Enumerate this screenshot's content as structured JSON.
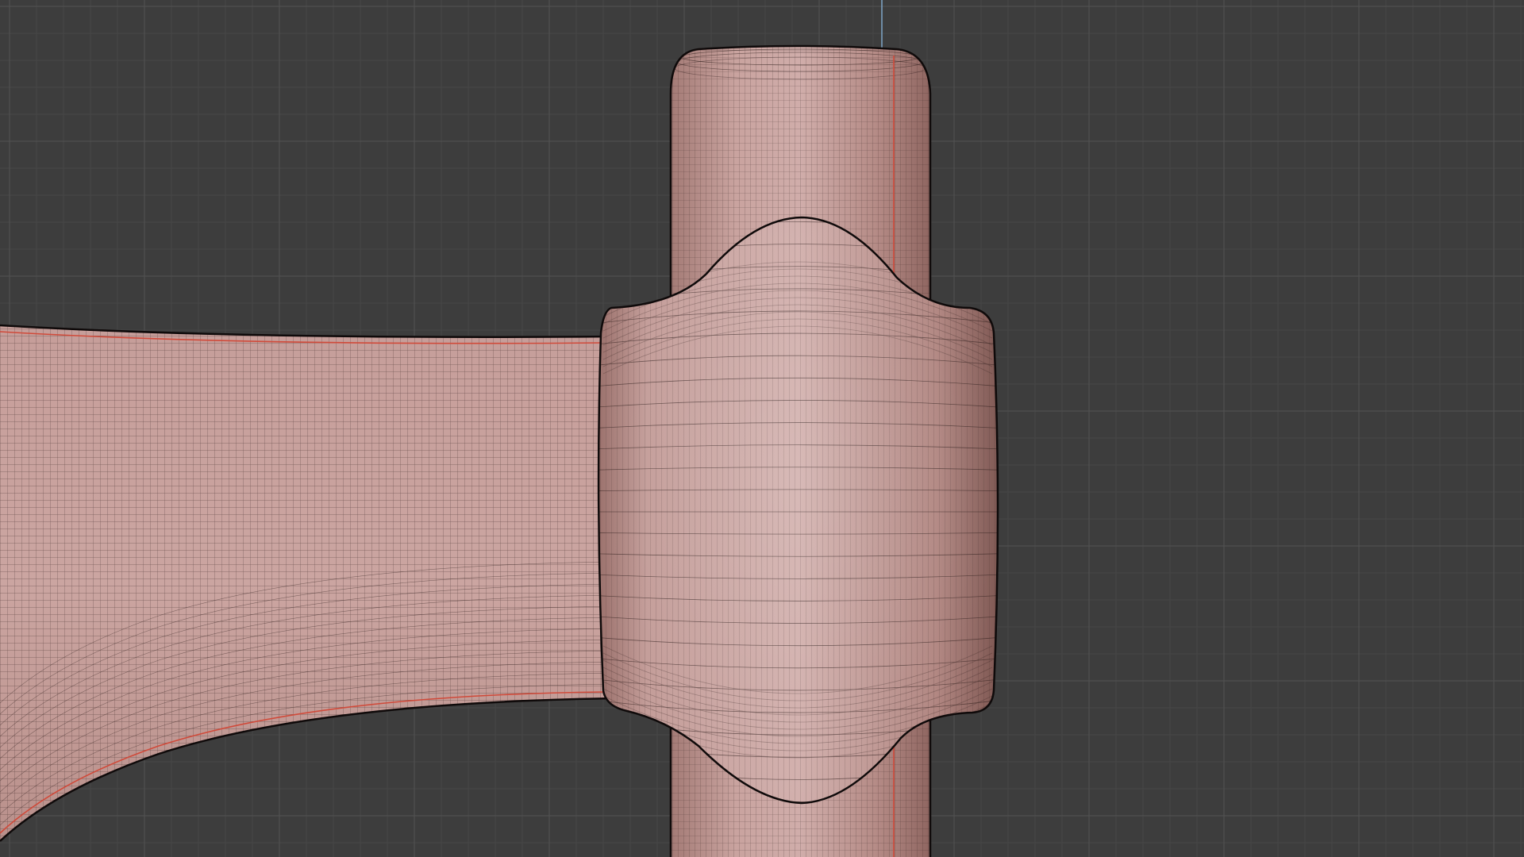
{
  "viewport": {
    "background": "#3d3d3d",
    "grid_minor_color": "#4a4a4a",
    "grid_major_color": "#555555",
    "axis_z_color": "#7fa6c8",
    "mesh_fill": "#c79f9b",
    "mesh_fill_dark": "#b08580",
    "mesh_shade": "#9c726d",
    "wire_color": "#2a1a18",
    "outline_color": "#0f0a0a",
    "seam_color": "#d04a3a"
  },
  "scene": {
    "objects": [
      "handle-cylinder",
      "head-body",
      "beam-arm"
    ]
  }
}
